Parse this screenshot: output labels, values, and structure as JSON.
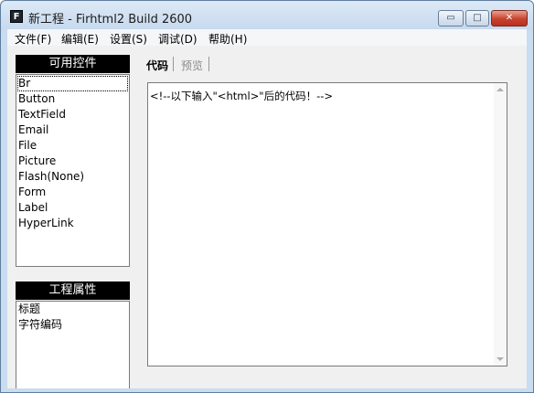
{
  "window": {
    "icon_letter": "F",
    "title": "新工程 - Firhtml2 Build 2600",
    "minimize_symbol": "▭",
    "maximize_symbol": "□",
    "close_symbol": "✕"
  },
  "menu": {
    "items": [
      {
        "label": "文件(F)"
      },
      {
        "label": "编辑(E)"
      },
      {
        "label": "设置(S)"
      },
      {
        "label": "调试(D)"
      },
      {
        "label": "帮助(H)"
      }
    ]
  },
  "controls_panel": {
    "title": "可用控件",
    "selected_index": 0,
    "items": [
      "Br",
      "Button",
      "TextField",
      "Email",
      "File",
      "Picture",
      "Flash(None)",
      "Form",
      "Label",
      "HyperLink"
    ]
  },
  "properties_panel": {
    "title": "工程属性",
    "items": [
      "标题",
      "字符编码"
    ]
  },
  "tabs": {
    "code": "代码",
    "preview": "预览"
  },
  "editor": {
    "content": "<!--以下输入\"<html>\"后的代码！-->"
  }
}
